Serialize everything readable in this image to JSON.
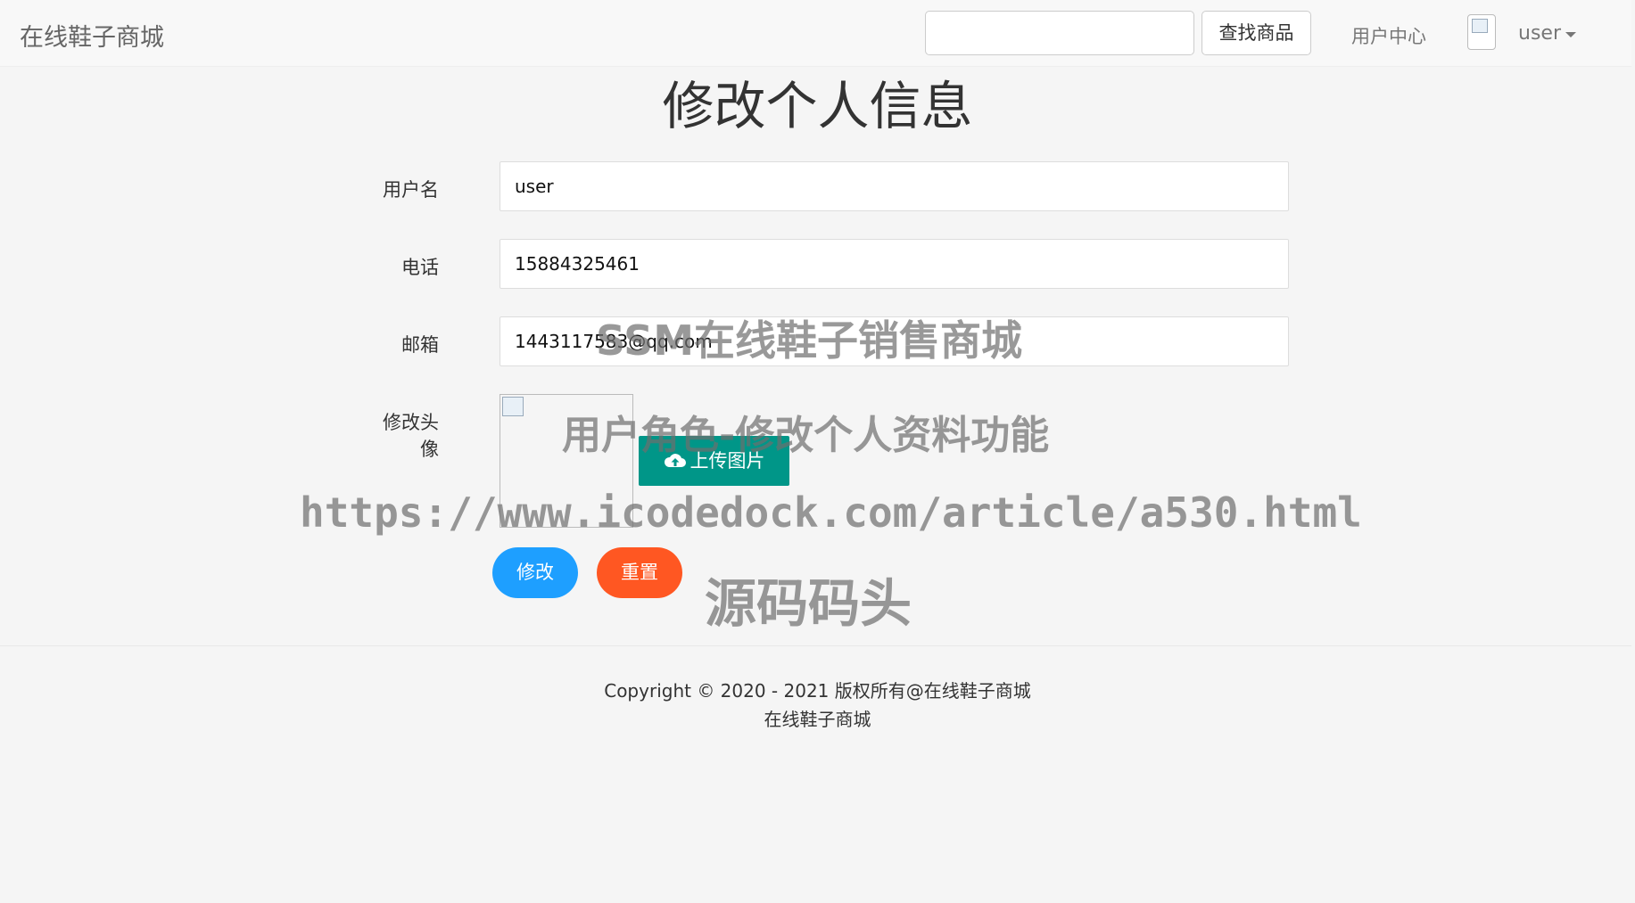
{
  "navbar": {
    "brand": "在线鞋子商城",
    "search_placeholder": "",
    "search_button": "查找商品",
    "user_center": "用户中心",
    "username": "user"
  },
  "form": {
    "title": "修改个人信息",
    "username_label": "用户名",
    "username_value": "user",
    "phone_label": "电话",
    "phone_value": "15884325461",
    "email_label": "邮箱",
    "email_value": "1443117583@qq.com",
    "avatar_label_line1": "修改头",
    "avatar_label_line2": "像",
    "upload_button": "上传图片",
    "submit_button": "修改",
    "reset_button": "重置"
  },
  "footer": {
    "copyright": "Copyright © 2020 - 2021 版权所有@在线鞋子商城",
    "site_name": "在线鞋子商城"
  },
  "watermarks": {
    "line1": "SSM在线鞋子销售商城",
    "line2": "用户角色-修改个人资料功能",
    "line3": "https://www.icodedock.com/article/a530.html",
    "line4": "源码码头"
  },
  "colors": {
    "upload": "#009688",
    "modify": "#1e9fff",
    "reset": "#ff5722"
  }
}
